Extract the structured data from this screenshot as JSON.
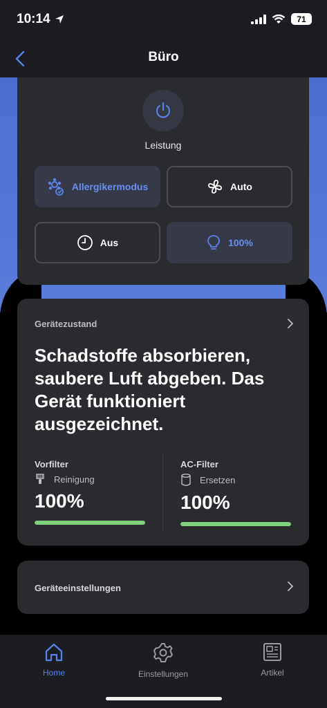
{
  "status": {
    "time": "10:14",
    "battery": "71"
  },
  "nav": {
    "title": "Büro"
  },
  "controls": {
    "power_label": "Leistung",
    "modes": [
      {
        "label": "Allergikermodus",
        "icon": "allergen-icon",
        "active": true
      },
      {
        "label": "Auto",
        "icon": "fan-icon",
        "active": false
      },
      {
        "label": "Aus",
        "icon": "clock-icon",
        "active": false
      },
      {
        "label": "100%",
        "icon": "bulb-icon",
        "active": true
      }
    ]
  },
  "device_state": {
    "heading": "Gerätezustand",
    "message": "Schadstoffe absorbieren, saubere Luft abgeben. Das Gerät funktioniert ausgezeichnet.",
    "filters": [
      {
        "name": "Vorfilter",
        "action": "Reinigung",
        "value": "100%",
        "fraction": 1.0
      },
      {
        "name": "AC-Filter",
        "action": "Ersetzen",
        "value": "100%",
        "fraction": 1.0
      }
    ]
  },
  "settings": {
    "label": "Geräteeinstellungen"
  },
  "tabs": [
    {
      "label": "Home",
      "icon": "home-icon",
      "active": true
    },
    {
      "label": "Einstellungen",
      "icon": "gear-icon",
      "active": false
    },
    {
      "label": "Artikel",
      "icon": "newspaper-icon",
      "active": false
    }
  ],
  "colors": {
    "accent": "#5b82ea",
    "filter_ok": "#7fd07d",
    "card": "#2a2b2f",
    "header_blue": "#5377d9"
  }
}
